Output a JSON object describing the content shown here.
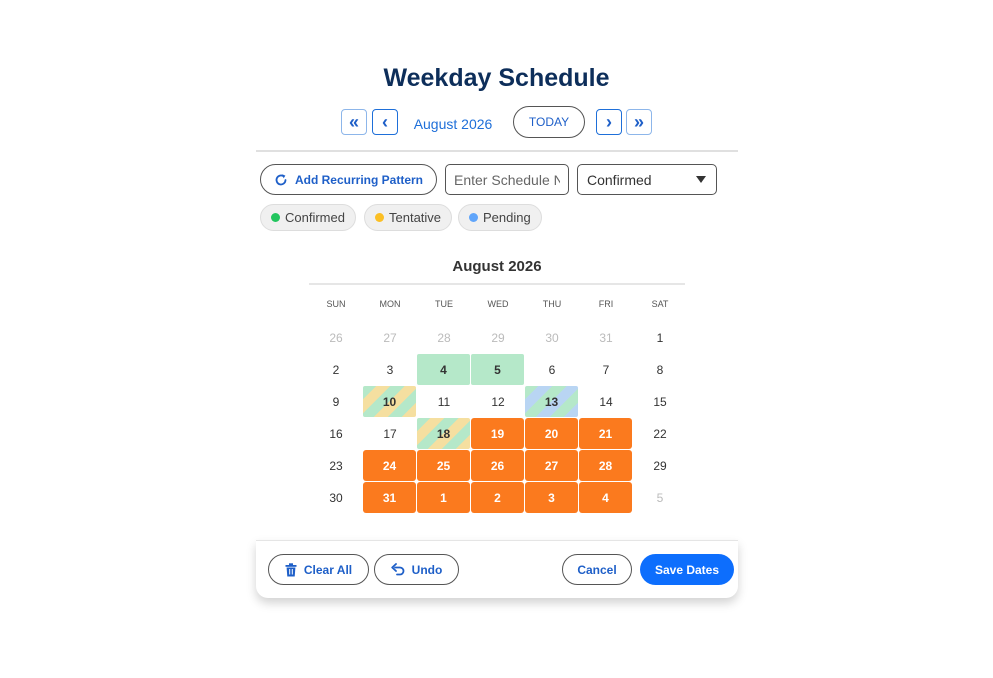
{
  "page": {
    "title": "Weekday Schedule"
  },
  "nav": {
    "prev_year": "«",
    "prev_month": "‹",
    "month_label": "August 2026",
    "today": "TODAY",
    "next_month": "›",
    "next_year": "»"
  },
  "toolbar": {
    "recurring_label": "Add Recurring Pattern",
    "schedule_name_placeholder": "Enter Schedule Name",
    "status_value": "Confirmed"
  },
  "legend": [
    {
      "label": "Confirmed",
      "color": "#22c55e"
    },
    {
      "label": "Tentative",
      "color": "#fbbf24"
    },
    {
      "label": "Pending",
      "color": "#60a5fa"
    }
  ],
  "calendar": {
    "title": "August 2026",
    "weekdays": [
      "SUN",
      "MON",
      "TUE",
      "WED",
      "THU",
      "FRI",
      "SAT"
    ],
    "weeks": [
      [
        {
          "d": "26",
          "s": "muted"
        },
        {
          "d": "27",
          "s": "muted"
        },
        {
          "d": "28",
          "s": "muted"
        },
        {
          "d": "29",
          "s": "muted"
        },
        {
          "d": "30",
          "s": "muted"
        },
        {
          "d": "31",
          "s": "muted"
        },
        {
          "d": "1",
          "s": ""
        }
      ],
      [
        {
          "d": "2",
          "s": ""
        },
        {
          "d": "3",
          "s": ""
        },
        {
          "d": "4",
          "s": "confirmed"
        },
        {
          "d": "5",
          "s": "confirmed"
        },
        {
          "d": "6",
          "s": ""
        },
        {
          "d": "7",
          "s": ""
        },
        {
          "d": "8",
          "s": ""
        }
      ],
      [
        {
          "d": "9",
          "s": ""
        },
        {
          "d": "10",
          "s": "stripe-gy"
        },
        {
          "d": "11",
          "s": ""
        },
        {
          "d": "12",
          "s": ""
        },
        {
          "d": "13",
          "s": "stripe-bg"
        },
        {
          "d": "14",
          "s": ""
        },
        {
          "d": "15",
          "s": ""
        }
      ],
      [
        {
          "d": "16",
          "s": ""
        },
        {
          "d": "17",
          "s": ""
        },
        {
          "d": "18",
          "s": "stripe-gy"
        },
        {
          "d": "19",
          "s": "sel"
        },
        {
          "d": "20",
          "s": "sel"
        },
        {
          "d": "21",
          "s": "sel"
        },
        {
          "d": "22",
          "s": ""
        }
      ],
      [
        {
          "d": "23",
          "s": ""
        },
        {
          "d": "24",
          "s": "sel"
        },
        {
          "d": "25",
          "s": "sel"
        },
        {
          "d": "26",
          "s": "sel"
        },
        {
          "d": "27",
          "s": "sel"
        },
        {
          "d": "28",
          "s": "sel"
        },
        {
          "d": "29",
          "s": ""
        }
      ],
      [
        {
          "d": "30",
          "s": ""
        },
        {
          "d": "31",
          "s": "sel"
        },
        {
          "d": "1",
          "s": "sel"
        },
        {
          "d": "2",
          "s": "sel"
        },
        {
          "d": "3",
          "s": "sel"
        },
        {
          "d": "4",
          "s": "sel"
        },
        {
          "d": "5",
          "s": "muted"
        }
      ]
    ]
  },
  "footer": {
    "clear_all": "Clear All",
    "undo": "Undo",
    "cancel": "Cancel",
    "save": "Save Dates"
  },
  "colors": {
    "accent": "#0d6efd",
    "selected": "#fb7a1e",
    "confirmed_fill": "#b5e8c9",
    "tentative_fill": "#f5dfa0",
    "pending_fill": "#b9d5f3"
  }
}
